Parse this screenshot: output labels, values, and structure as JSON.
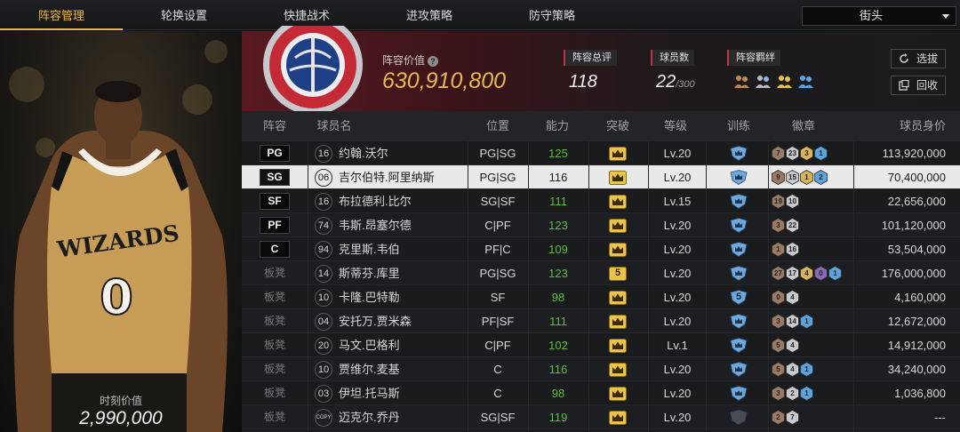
{
  "tabs": [
    {
      "label": "阵容管理",
      "active": true
    },
    {
      "label": "轮换设置",
      "active": false
    },
    {
      "label": "快捷战术",
      "active": false
    },
    {
      "label": "进攻策略",
      "active": false
    },
    {
      "label": "防守策略",
      "active": false
    }
  ],
  "mode_select": {
    "value": "街头"
  },
  "player_panel": {
    "label": "时刻价值",
    "value": "2,990,000",
    "jersey": "WIZARDS",
    "jersey_number": "0"
  },
  "summary": {
    "value_label": "阵容价值",
    "value": "630,910,800",
    "rating_label": "阵容总评",
    "rating": "118",
    "count_label": "球员数",
    "count": "22",
    "count_max": "/300",
    "bond_label": "阵容羁绊",
    "bond_icons": [
      "bond-icon-1",
      "bond-icon-2",
      "bond-icon-3",
      "bond-icon-4"
    ],
    "filter_button": "选拔",
    "recycle_button": "回收"
  },
  "columns": [
    "阵容",
    "球员名",
    "位置",
    "能力",
    "突破",
    "等级",
    "训练",
    "徽章",
    "球员身价"
  ],
  "colors": {
    "accent": "#e8b850",
    "ability": "#5cbd3c",
    "team_red": "#c0343f"
  },
  "rows": [
    {
      "slot": "PG",
      "bench": false,
      "num": "16",
      "name": "约翰.沃尔",
      "pos": "PG|SG",
      "ability": "125",
      "breakthrough": "crown",
      "level": "Lv.20",
      "training": "",
      "badges": [
        [
          "7",
          "bronze"
        ],
        [
          "23",
          "silver"
        ],
        [
          "3",
          "gold"
        ],
        [
          "1",
          "blue"
        ]
      ],
      "salary": "113,920,000"
    },
    {
      "slot": "SG",
      "bench": false,
      "num": "06",
      "name": "吉尔伯特.阿里纳斯",
      "pos": "PG|SG",
      "ability": "116",
      "breakthrough": "crown",
      "level": "Lv.20",
      "training": "",
      "badges": [
        [
          "9",
          "bronze"
        ],
        [
          "15",
          "silver"
        ],
        [
          "1",
          "gold"
        ],
        [
          "2",
          "blue"
        ]
      ],
      "salary": "70,400,000",
      "selected": true
    },
    {
      "slot": "SF",
      "bench": false,
      "num": "16",
      "name": "布拉德利.比尔",
      "pos": "SG|SF",
      "ability": "111",
      "breakthrough": "crown",
      "level": "Lv.15",
      "training": "",
      "badges": [
        [
          "19",
          "bronze"
        ],
        [
          "10",
          "silver"
        ]
      ],
      "salary": "22,656,000"
    },
    {
      "slot": "PF",
      "bench": false,
      "num": "74",
      "name": "韦斯.昂塞尔德",
      "pos": "C|PF",
      "ability": "123",
      "breakthrough": "crown",
      "level": "Lv.20",
      "training": "",
      "badges": [
        [
          "3",
          "bronze"
        ],
        [
          "22",
          "silver"
        ]
      ],
      "salary": "101,120,000"
    },
    {
      "slot": "C",
      "bench": false,
      "num": "94",
      "name": "克里斯.韦伯",
      "pos": "PF|C",
      "ability": "109",
      "breakthrough": "crown",
      "level": "Lv.20",
      "training": "",
      "badges": [
        [
          "1",
          "bronze"
        ],
        [
          "16",
          "silver"
        ]
      ],
      "salary": "53,504,000"
    },
    {
      "slot": "板凳",
      "bench": true,
      "num": "14",
      "name": "斯蒂芬.库里",
      "pos": "PG|SG",
      "ability": "123",
      "breakthrough": "5",
      "level": "Lv.20",
      "training": "",
      "badges": [
        [
          "27",
          "bronze"
        ],
        [
          "17",
          "silver"
        ],
        [
          "4",
          "gold"
        ],
        [
          "0",
          "purple"
        ],
        [
          "1",
          "blue"
        ]
      ],
      "salary": "176,000,000"
    },
    {
      "slot": "板凳",
      "bench": true,
      "num": "10",
      "name": "卡隆.巴特勒",
      "pos": "SF",
      "ability": "98",
      "breakthrough": "crown",
      "level": "Lv.20",
      "training": "5",
      "badges": [
        [
          "0",
          "bronze"
        ],
        [
          "4",
          "silver"
        ]
      ],
      "salary": "4,160,000"
    },
    {
      "slot": "板凳",
      "bench": true,
      "num": "04",
      "name": "安托万.贾米森",
      "pos": "PF|SF",
      "ability": "111",
      "breakthrough": "crown",
      "level": "Lv.20",
      "training": "",
      "badges": [
        [
          "3",
          "bronze"
        ],
        [
          "14",
          "silver"
        ],
        [
          "1",
          "blue"
        ]
      ],
      "salary": "12,672,000"
    },
    {
      "slot": "板凳",
      "bench": true,
      "num": "20",
      "name": "马文.巴格利",
      "pos": "C|PF",
      "ability": "102",
      "breakthrough": "crown",
      "level": "Lv.1",
      "training": "",
      "badges": [
        [
          "5",
          "bronze"
        ],
        [
          "4",
          "silver"
        ]
      ],
      "salary": "14,912,000"
    },
    {
      "slot": "板凳",
      "bench": true,
      "num": "10",
      "name": "贾维尔.麦基",
      "pos": "C",
      "ability": "116",
      "breakthrough": "crown",
      "level": "Lv.20",
      "training": "",
      "badges": [
        [
          "5",
          "bronze"
        ],
        [
          "4",
          "silver"
        ],
        [
          "1",
          "blue"
        ]
      ],
      "salary": "34,240,000"
    },
    {
      "slot": "板凳",
      "bench": true,
      "num": "03",
      "name": "伊坦.托马斯",
      "pos": "C",
      "ability": "98",
      "breakthrough": "crown",
      "level": "Lv.20",
      "training": "",
      "badges": [
        [
          "3",
          "bronze"
        ],
        [
          "2",
          "silver"
        ],
        [
          "1",
          "blue"
        ]
      ],
      "salary": "1,036,800"
    },
    {
      "slot": "板凳",
      "bench": true,
      "num": "COPY",
      "name": "迈克尔.乔丹",
      "pos": "SG|SF",
      "ability": "119",
      "breakthrough": "crown",
      "level": "Lv.20",
      "training": "grey",
      "badges": [
        [
          "2",
          "bronze"
        ],
        [
          "7",
          "silver"
        ]
      ],
      "salary": "---"
    }
  ]
}
